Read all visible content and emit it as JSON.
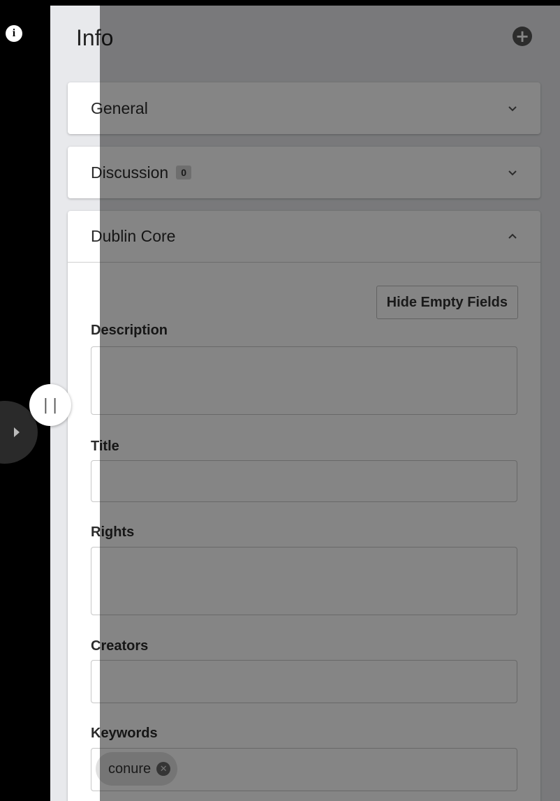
{
  "toggle": {
    "icon": "info-icon",
    "glyph": "i"
  },
  "panel": {
    "title": "Info",
    "add_icon": "plus-circle-icon",
    "add_glyph": "+"
  },
  "sections": {
    "general": {
      "label": "General",
      "icon": "chevron-down-icon"
    },
    "discussion": {
      "label": "Discussion",
      "count": "0",
      "icon": "chevron-down-icon"
    },
    "dublin_core": {
      "label": "Dublin Core",
      "icon": "chevron-up-icon",
      "expanded": true
    }
  },
  "dublin_core": {
    "hide_empty_label": "Hide Empty Fields",
    "fields": {
      "description": {
        "label": "Description",
        "value": ""
      },
      "title": {
        "label": "Title",
        "value": ""
      },
      "rights": {
        "label": "Rights",
        "value": ""
      },
      "creators": {
        "label": "Creators",
        "value": ""
      },
      "keywords": {
        "label": "Keywords",
        "chips": [
          "conure"
        ]
      }
    }
  },
  "resize_handle": {
    "glyph": "||",
    "icon": "resize-handle-icon"
  },
  "colors": {
    "panel_bg": "#e8e9ec",
    "overlay": "rgba(0,0,0,0.48)",
    "badge_bg": "#d4d4d4"
  }
}
